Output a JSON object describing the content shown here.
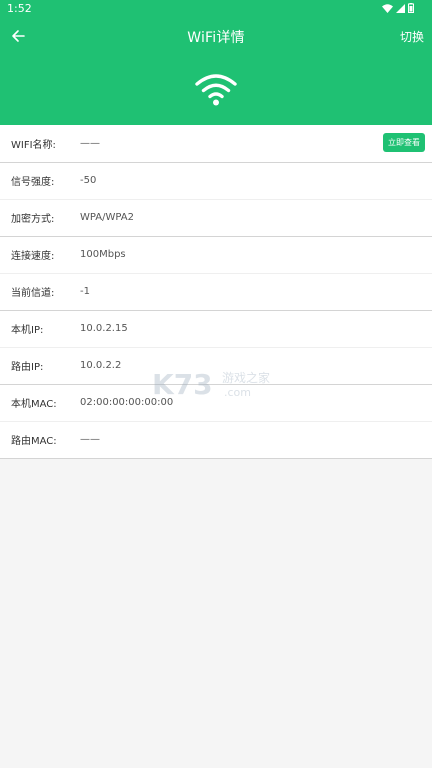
{
  "status": {
    "time": "1:52"
  },
  "appbar": {
    "title": "WiFi详情",
    "switch_label": "切换"
  },
  "details": {
    "wifi_name": {
      "label": "WIFI名称:",
      "value": "——",
      "action": "立即查看"
    },
    "signal": {
      "label": "信号强度:",
      "value": "-50"
    },
    "encryption": {
      "label": "加密方式:",
      "value": "WPA/WPA2"
    },
    "speed": {
      "label": "连接速度:",
      "value": "100Mbps"
    },
    "channel": {
      "label": "当前信道:",
      "value": "-1"
    },
    "local_ip": {
      "label": "本机IP:",
      "value": "10.0.2.15"
    },
    "router_ip": {
      "label": "路由IP:",
      "value": "10.0.2.2"
    },
    "local_mac": {
      "label": "本机MAC:",
      "value": "02:00:00:00:00:00"
    },
    "router_mac": {
      "label": "路由MAC:",
      "value": "——"
    }
  },
  "watermark": {
    "brand": "K73",
    "text": "游戏之家",
    "domain": ".com"
  },
  "colors": {
    "accent": "#1fc173",
    "background": "#f5f5f5"
  }
}
